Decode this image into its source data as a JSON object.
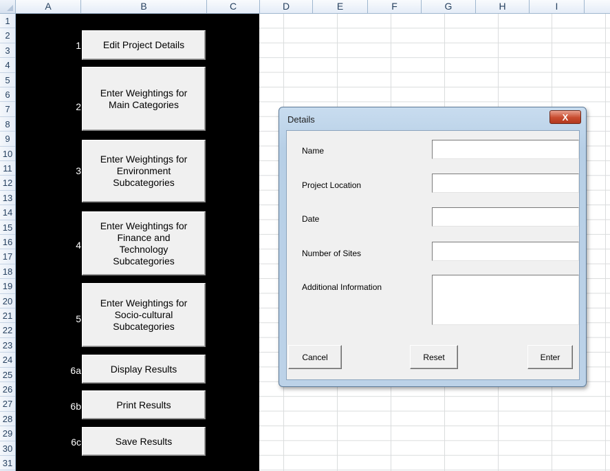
{
  "spreadsheet": {
    "columns": [
      "A",
      "B",
      "C",
      "D",
      "E",
      "F",
      "G",
      "H",
      "I"
    ],
    "rows": [
      "1",
      "2",
      "3",
      "4",
      "5",
      "6",
      "7",
      "8",
      "9",
      "10",
      "11",
      "12",
      "13",
      "14",
      "15",
      "16",
      "17",
      "18",
      "19",
      "20",
      "21",
      "22",
      "23",
      "24",
      "25",
      "26",
      "27",
      "28",
      "29",
      "30",
      "31"
    ]
  },
  "steps": [
    {
      "num": "1",
      "label": "Edit Project Details"
    },
    {
      "num": "2",
      "label": "Enter Weightings for\nMain Categories"
    },
    {
      "num": "3",
      "label": "Enter Weightings for\nEnvironment\nSubcategories"
    },
    {
      "num": "4",
      "label": "Enter Weightings for\nFinance and\nTechnology\nSubcategories"
    },
    {
      "num": "5",
      "label": "Enter Weightings for\nSocio-cultural\nSubcategories"
    },
    {
      "num": "6a",
      "label": "Display Results"
    },
    {
      "num": "6b",
      "label": "Print Results"
    },
    {
      "num": "6c",
      "label": "Save Results"
    }
  ],
  "dialog": {
    "title": "Details",
    "close_glyph": "X",
    "fields": [
      {
        "label": "Name",
        "value": ""
      },
      {
        "label": "Project Location",
        "value": ""
      },
      {
        "label": "Date",
        "value": ""
      },
      {
        "label": "Number of Sites",
        "value": ""
      },
      {
        "label": "Additional Information",
        "value": ""
      }
    ],
    "buttons": {
      "cancel": "Cancel",
      "reset": "Reset",
      "enter": "Enter"
    }
  }
}
